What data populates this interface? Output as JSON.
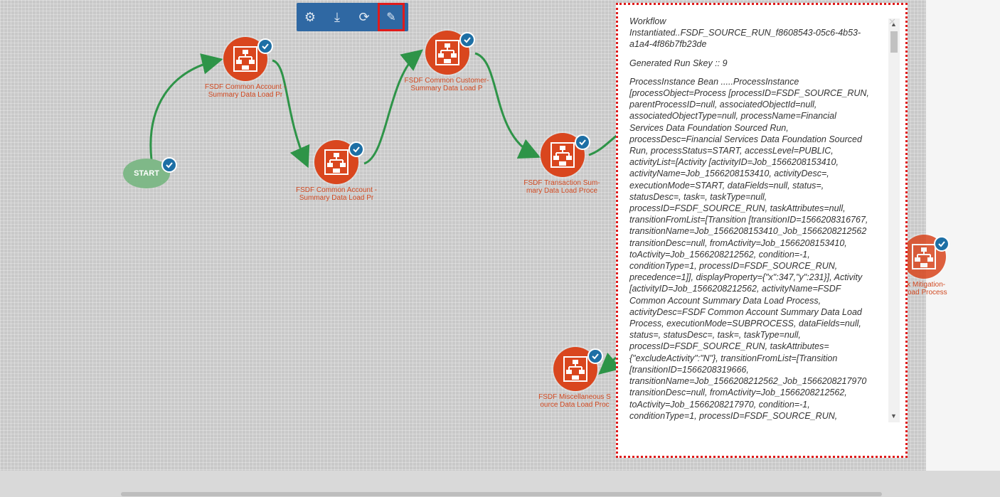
{
  "toolbar": {
    "buttons": [
      {
        "icon": "gear-icon",
        "glyph": "⚙"
      },
      {
        "icon": "download-icon",
        "glyph": "⤓"
      },
      {
        "icon": "refresh-icon",
        "glyph": "⟳"
      },
      {
        "icon": "edit-icon",
        "glyph": "✎"
      }
    ]
  },
  "nodes": {
    "start": {
      "label": "START"
    },
    "n1": {
      "label_line1": "FSDF Common Account -",
      "label_line2": "Summary Data Load Pr"
    },
    "n2": {
      "label_line1": "FSDF Common Account -",
      "label_line2": "Summary Data Load Pr"
    },
    "n3": {
      "label_line1": "FSDF Common Customer-",
      "label_line2": "Summary Data Load P"
    },
    "n4": {
      "label_line1": "FSDF Transaction Sum-",
      "label_line2": "mary Data Load Proce"
    },
    "n5": {
      "label_line1": "FSDF Miscellaneous S",
      "label_line2": "ource Data Load Proc"
    },
    "n6": {
      "label_line1": "isk Mitigation-",
      "label_line2": "oad Process"
    }
  },
  "log": {
    "para1": [
      "Workflow",
      "Instantiated..FSDF_SOURCE_RUN_f8608543-05c6-4b53-",
      "a1a4-4f86b7fb23de"
    ],
    "para2": [
      "Generated Run Skey :: 9"
    ],
    "para3": [
      "ProcessInstance Bean .....ProcessInstance",
      "[processObject=Process [processID=FSDF_SOURCE_RUN,",
      "parentProcessID=null, associatedObjectId=null,",
      "associatedObjectType=null, processName=Financial",
      "Services Data Foundation Sourced Run,",
      "processDesc=Financial Services Data Foundation Sourced",
      "Run, processStatus=START, accessLevel=PUBLIC,",
      "activityList=[Activity [activityID=Job_1566208153410,",
      "activityName=Job_1566208153410, activityDesc=,",
      "executionMode=START, dataFields=null, status=,",
      "statusDesc=, task=, taskType=null,",
      "processID=FSDF_SOURCE_RUN, taskAttributes=null,",
      "transitionFromList=[Transition [transitionID=1566208316767,",
      "transitionName=Job_1566208153410_Job_1566208212562",
      "transitionDesc=null, fromActivity=Job_1566208153410,",
      "toActivity=Job_1566208212562, condition=-1,",
      "conditionType=1, processID=FSDF_SOURCE_RUN,",
      "precedence=1]], displayProperty={\"x\":347,\"y\":231}], Activity",
      "[activityID=Job_1566208212562, activityName=FSDF",
      "Common Account Summary Data Load Process,",
      "activityDesc=FSDF Common Account Summary Data Load",
      "Process, executionMode=SUBPROCESS, dataFields=null,",
      "status=, statusDesc=, task=, taskType=null,",
      "processID=FSDF_SOURCE_RUN, taskAttributes=",
      "{\"excludeActivity\":\"N\"}, transitionFromList=[Transition",
      "[transitionID=1566208319666,",
      "transitionName=Job_1566208212562_Job_1566208217970",
      "transitionDesc=null, fromActivity=Job_1566208212562,",
      "toActivity=Job_1566208217970, condition=-1,",
      "conditionType=1, processID=FSDF_SOURCE_RUN,"
    ],
    "close_glyph": "✕",
    "scroll_up": "▲",
    "scroll_down": "▼"
  },
  "colors": {
    "node": "#d9461e",
    "edge": "#2e9448",
    "toolbar": "#2f68a3",
    "highlight": "#e01b1b"
  }
}
